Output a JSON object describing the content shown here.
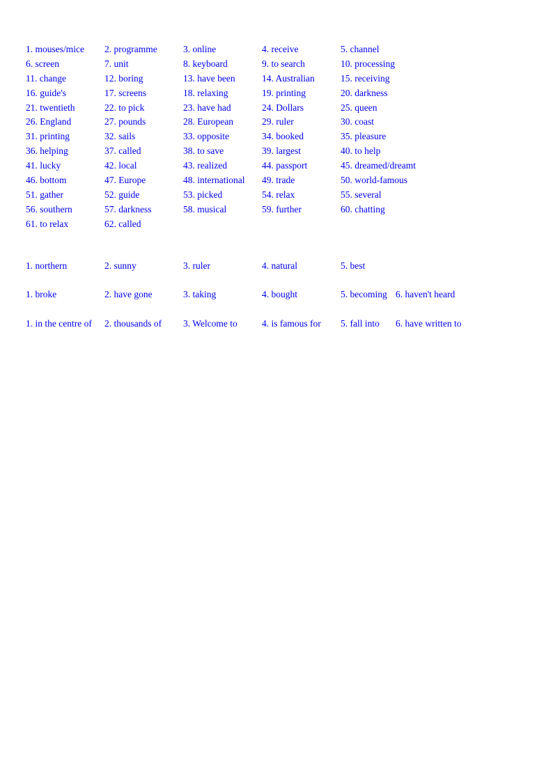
{
  "document": {
    "text_color": "#0000ee",
    "background_color": "#ffffff"
  },
  "sections": {
    "vocabulary": {
      "columns": 5,
      "rows": [
        [
          "1. mouses/mice",
          "2. programme",
          "3. online",
          "4. receive",
          "5. channel"
        ],
        [
          "6. screen",
          "7. unit",
          "8. keyboard",
          "9. to search",
          "10. processing"
        ],
        [
          "11. change",
          "12. boring",
          "13. have been",
          "14. Australian",
          "15. receiving"
        ],
        [
          "16. guide's",
          "17. screens",
          "18. relaxing",
          "19. printing",
          "20. darkness"
        ],
        [
          "21. twentieth",
          "22. to pick",
          "23. have had",
          "24. Dollars",
          "25. queen"
        ],
        [
          "26. England",
          "27. pounds",
          "28. European",
          "29. ruler",
          "30. coast"
        ],
        [
          "31. printing",
          "32. sails",
          "33. opposite",
          "34. booked",
          "35. pleasure"
        ],
        [
          "36. helping",
          "37. called",
          "38. to save",
          "39. largest",
          "40. to help"
        ],
        [
          "41. lucky",
          "42. local",
          "43. realized",
          "44. passport",
          "45. dreamed/dreamt"
        ],
        [
          "46. bottom",
          "47. Europe",
          "48. international",
          "49. trade",
          "50. world-famous"
        ],
        [
          "51. gather",
          "52. guide",
          "53. picked",
          "54. relax",
          "55. several"
        ],
        [
          "56. southern",
          "57. darkness",
          "58. musical",
          "59. further",
          "60. chatting"
        ],
        [
          "61. to relax",
          "62. called",
          "",
          "",
          ""
        ]
      ]
    },
    "word_forms": {
      "items": [
        "1. northern",
        "2. sunny",
        "3. ruler",
        "4. natural",
        "5. best",
        ""
      ]
    },
    "verb_tenses": {
      "items": [
        "1. broke",
        "2. have gone",
        "3. taking",
        "4. bought",
        "5. becoming",
        "6. haven't heard"
      ]
    },
    "phrases": {
      "items": [
        "1. in the centre of",
        "2. thousands of",
        "3. Welcome to",
        "4. is famous for",
        "5. fall into",
        "6. have written to"
      ]
    }
  }
}
